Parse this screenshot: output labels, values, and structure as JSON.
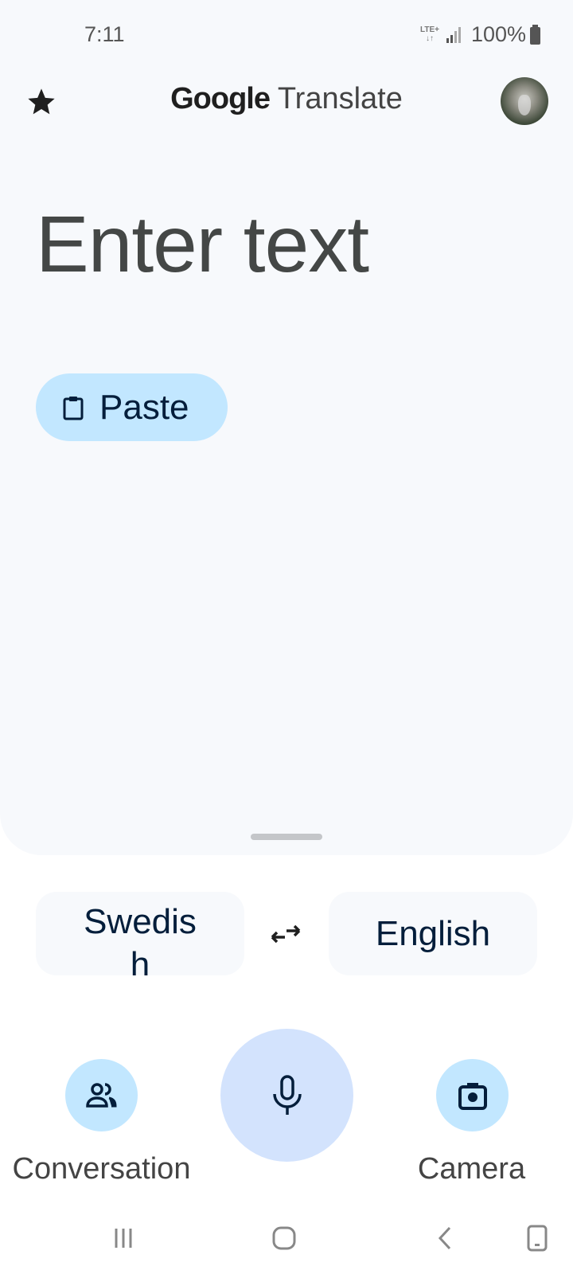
{
  "status_bar": {
    "time": "7:11",
    "network": "LTE+",
    "battery": "100%"
  },
  "header": {
    "logo_google": "Google",
    "logo_product": "Translate",
    "favorites_icon": "star-icon",
    "account_icon": "avatar"
  },
  "input": {
    "placeholder": "Enter text"
  },
  "paste_button": {
    "label": "Paste",
    "icon": "clipboard-icon"
  },
  "languages": {
    "source": "Swedish",
    "target": "English",
    "swap_icon": "swap-icon"
  },
  "actions": [
    {
      "label": "Conversation",
      "icon": "people-icon"
    },
    {
      "label": "",
      "icon": "mic-icon"
    },
    {
      "label": "Camera",
      "icon": "camera-icon"
    }
  ],
  "colors": {
    "card_bg": "#f7f9fc",
    "chip_bg": "#c2e7ff",
    "mic_bg": "#d3e3fd",
    "text_dark": "#041e3b"
  },
  "nav_bar": {
    "buttons": [
      "recent-apps",
      "home",
      "back",
      "keyboard-toggle"
    ]
  }
}
